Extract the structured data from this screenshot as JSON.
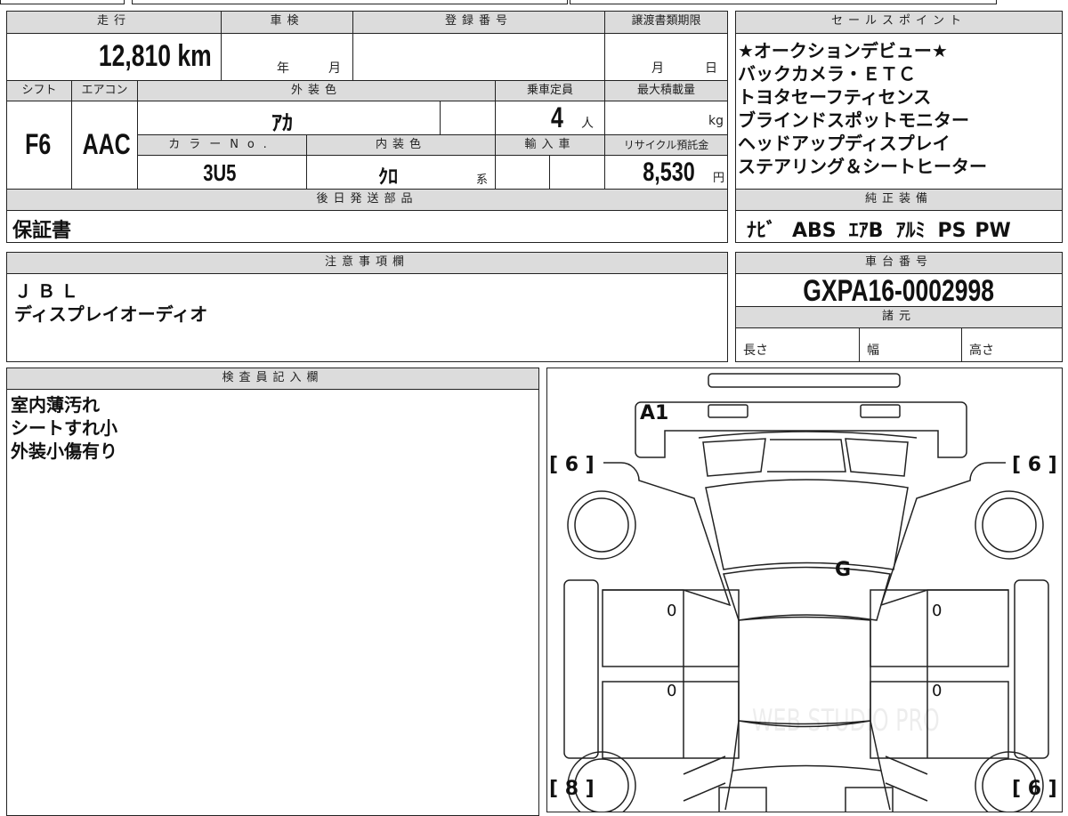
{
  "vehicle": {
    "mileage_label": "走行",
    "mileage": "12,810",
    "mileage_unit": "km",
    "inspection_label": "車検",
    "inspection_year_unit": "年",
    "inspection_month_unit": "月",
    "registration_label": "登録番号",
    "registration": "",
    "transfer_deadline_label": "譲渡書類期限",
    "transfer_month_unit": "月",
    "transfer_day_unit": "日",
    "shift_label": "シフト",
    "shift": "F6",
    "aircon_label": "エアコン",
    "aircon": "AAC",
    "exterior_color_label": "外装色",
    "exterior_color": "ｱｶ",
    "capacity_label": "乗車定員",
    "capacity": "4",
    "capacity_unit": "人",
    "max_load_label": "最大積載量",
    "max_load_unit": "kg",
    "color_no_label": "カラーNo.",
    "color_no": "3U5",
    "interior_color_label": "内装色",
    "interior_color": "ｸﾛ",
    "interior_suffix": "系",
    "import_label": "輸入車",
    "recycle_label": "リサイクル預託金",
    "recycle_fee": "8,530",
    "recycle_unit": "円"
  },
  "later_parts": {
    "label": "後日発送部品",
    "value": "保証書"
  },
  "sales_points": {
    "label": "セールスポイント",
    "items": [
      "★オークションデビュー★",
      "バックカメラ・ＥＴＣ",
      "トヨタセーフティセンス",
      "ブラインドスポットモニター",
      "ヘッドアップディスプレイ",
      "ステアリング＆シートヒーター"
    ]
  },
  "equipment": {
    "label": "純正装備",
    "items": [
      "ﾅﾋﾞ",
      "ABS",
      "ｴｱB",
      "ｱﾙﾐ",
      "PS",
      "PW"
    ]
  },
  "notes": {
    "label": "注意事項欄",
    "lines": [
      "ＪＢＬ",
      "ディスプレイオーディオ"
    ]
  },
  "chassis": {
    "label": "車台番号",
    "value": "GXPA16-0002998",
    "spec_label": "諸元",
    "length_label": "長さ",
    "width_label": "幅",
    "height_label": "高さ"
  },
  "inspector": {
    "label": "検査員記入欄",
    "lines": [
      "室内薄汚れ",
      "シートすれ小",
      "外装小傷有り"
    ]
  },
  "diagram": {
    "marks": {
      "front": "A1",
      "windshield": "G",
      "door_fl": "0",
      "door_rl": "0",
      "door_fr": "0",
      "door_rr": "0"
    },
    "tread": {
      "front_left": "[ 6 ]",
      "front_right": "[ 6 ]",
      "rear_left": "[ 8 ]",
      "rear_right": "[ 6 ]"
    },
    "watermark": "WEB STUDIO PRO"
  }
}
